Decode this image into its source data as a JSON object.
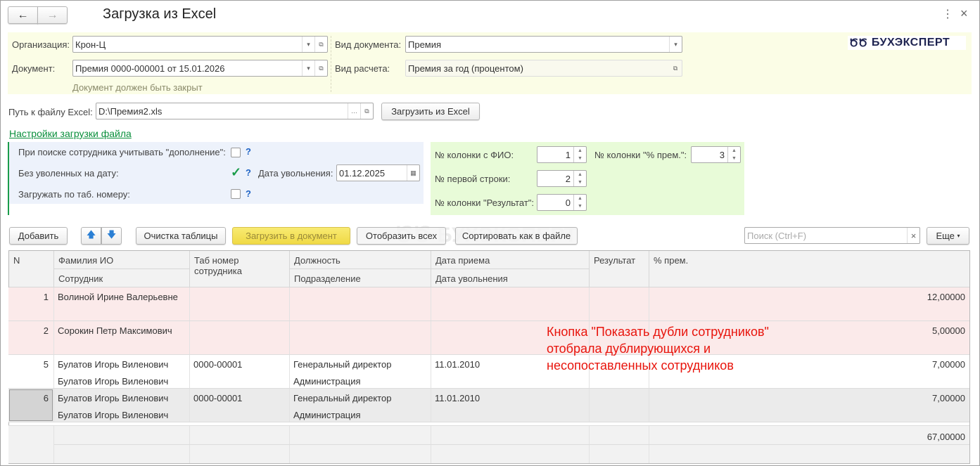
{
  "window": {
    "title": "Загрузка из Excel",
    "back_icon": "arrow-left",
    "forward_icon": "arrow-right",
    "more_icon": "⋮",
    "close_icon": "×"
  },
  "header_panel": {
    "org_label": "Организация:",
    "org_value": "Крон-Ц",
    "doc_label": "Документ:",
    "doc_value": "Премия 0000-000001 от 15.01.2026",
    "doc_note": "Документ должен быть закрыт",
    "doctype_label": "Вид документа:",
    "doctype_value": "Премия",
    "calc_label": "Вид расчета:",
    "calc_value": "Премия за год (процентом)",
    "logo_text": "БУХЭКСПЕРТ"
  },
  "file": {
    "label": "Путь к файлу Excel:",
    "value": "D:\\Премия2.xls",
    "load_button": "Загрузить из Excel",
    "settings_link": "Настройки загрузки файла"
  },
  "options": {
    "addition_label": "При поиске сотрудника учитывать \"дополнение\":",
    "addition_checked": false,
    "no_fired_label": "Без уволенных на дату:",
    "no_fired_checked": true,
    "fire_date_label": "Дата увольнения:",
    "fire_date_value": "01.12.2025",
    "by_tab_label": "Загружать по таб. номеру:",
    "by_tab_checked": false,
    "help": "?"
  },
  "columns_settings": {
    "fio_label": "№ колонки с ФИО:",
    "fio_value": "1",
    "prem_label": "№ колонки \"% прем.\":",
    "prem_value": "3",
    "first_row_label": "№ первой строки:",
    "first_row_value": "2",
    "result_label": "№ колонки \"Результат\":",
    "result_value": "0"
  },
  "toolbar": {
    "add": "Добавить",
    "clear": "Очистка таблицы",
    "load_doc": "Загрузить в документ",
    "show_all": "Отобразить всех",
    "sort": "Сортировать как в файле",
    "search_placeholder": "Поиск (Ctrl+F)",
    "search_clear": "×",
    "more": "Еще"
  },
  "table": {
    "headers": {
      "n": "N",
      "fio": "Фамилия ИО",
      "employee": "Сотрудник",
      "tab": "Таб номер сотрудника",
      "position": "Должность",
      "department": "Подразделение",
      "hire": "Дата приема",
      "fire": "Дата увольнения",
      "result": "Результат",
      "percent": "% прем."
    },
    "rows": [
      {
        "n": "1",
        "fio": "Волиной Ирине Валерьевне",
        "employee": "",
        "tab": "",
        "position": "",
        "department": "",
        "hire": "",
        "fire": "",
        "result": "",
        "percent": "12,00000"
      },
      {
        "n": "2",
        "fio": "Сорокин Петр Максимович",
        "employee": "",
        "tab": "",
        "position": "",
        "department": "",
        "hire": "",
        "fire": "",
        "result": "",
        "percent": "5,00000"
      },
      {
        "n": "5",
        "fio": "Булатов Игорь Виленович",
        "employee": "Булатов Игорь Виленович",
        "tab": "0000-00001",
        "position": "Генеральный директор",
        "department": "Администрация",
        "hire": "11.01.2010",
        "fire": "",
        "result": "",
        "percent": "7,00000"
      },
      {
        "n": "6",
        "fio": "Булатов Игорь Виленович",
        "employee": "Булатов Игорь Виленович",
        "tab": "0000-00001",
        "position": "Генеральный директор",
        "department": "Администрация",
        "hire": "11.01.2010",
        "fire": "",
        "result": "",
        "percent": "7,00000"
      }
    ],
    "total": "67,00000"
  },
  "annotation": {
    "lines": [
      "Кнопка \"Показать дубли сотрудников\"",
      "отобрала дублирующихся и",
      "несопоставленных сотрудников"
    ]
  },
  "colors": {
    "yellow_panel": "#fbfde6",
    "blue_panel": "#edf2fb",
    "green_panel": "#e8fbd8",
    "pink_row": "#fbeaea",
    "link": "#0a8f3c",
    "annotation": "#e8140c",
    "accent_button": "#f4e25a"
  }
}
